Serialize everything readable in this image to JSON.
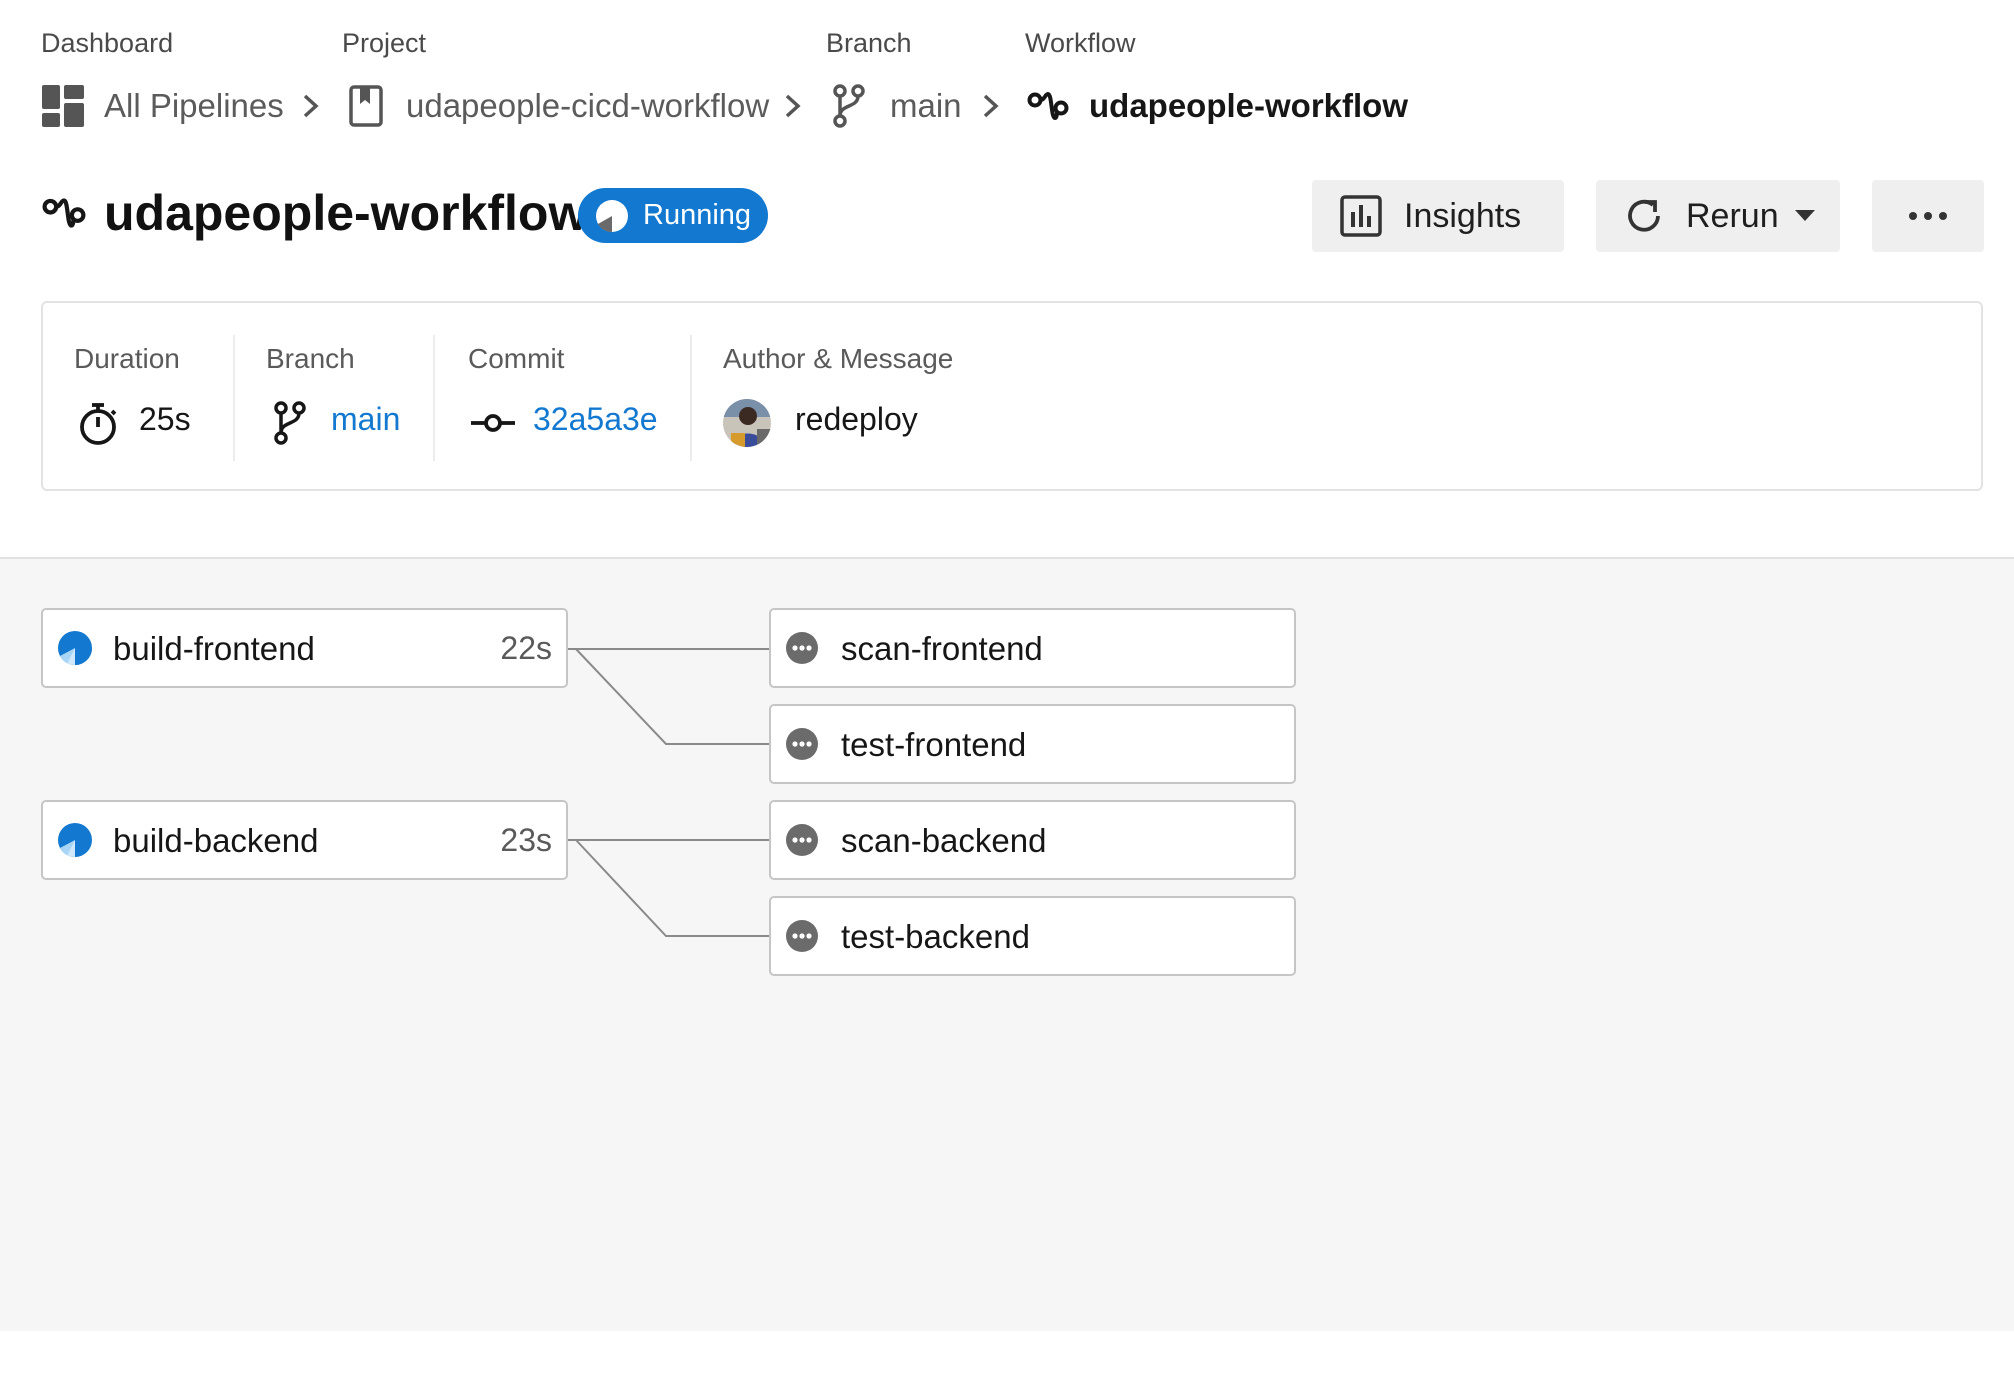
{
  "breadcrumb": {
    "captions": [
      "Dashboard",
      "Project",
      "Branch",
      "Workflow"
    ],
    "all_pipelines": "All Pipelines",
    "project": "udapeople-cicd-workflow",
    "branch": "main",
    "workflow": "udapeople-workflow"
  },
  "header": {
    "title": "udapeople-workflow",
    "status": "Running",
    "insights_label": "Insights",
    "rerun_label": "Rerun"
  },
  "info": {
    "duration_caption": "Duration",
    "duration_value": "25s",
    "branch_caption": "Branch",
    "branch_value": "main",
    "commit_caption": "Commit",
    "commit_value": "32a5a3e",
    "author_caption": "Author & Message",
    "message": "redeploy"
  },
  "jobs": [
    {
      "name": "build-frontend",
      "duration": "22s",
      "state": "running"
    },
    {
      "name": "build-backend",
      "duration": "23s",
      "state": "running"
    },
    {
      "name": "scan-frontend",
      "state": "queued"
    },
    {
      "name": "test-frontend",
      "state": "queued"
    },
    {
      "name": "scan-backend",
      "state": "queued"
    },
    {
      "name": "test-backend",
      "state": "queued"
    }
  ],
  "colors": {
    "accent": "#1278d0",
    "queued_icon": "#6b6b6b",
    "graph_background": "#f6f6f6"
  },
  "icons": {
    "dashboard": "grid-icon",
    "project": "bookmark-icon",
    "branch": "git-branch-icon",
    "workflow": "workflow-icon",
    "duration": "stopwatch-icon",
    "commit": "git-commit-icon",
    "insights": "bar-chart-icon",
    "rerun": "refresh-icon",
    "more": "more-horizontal-icon"
  }
}
